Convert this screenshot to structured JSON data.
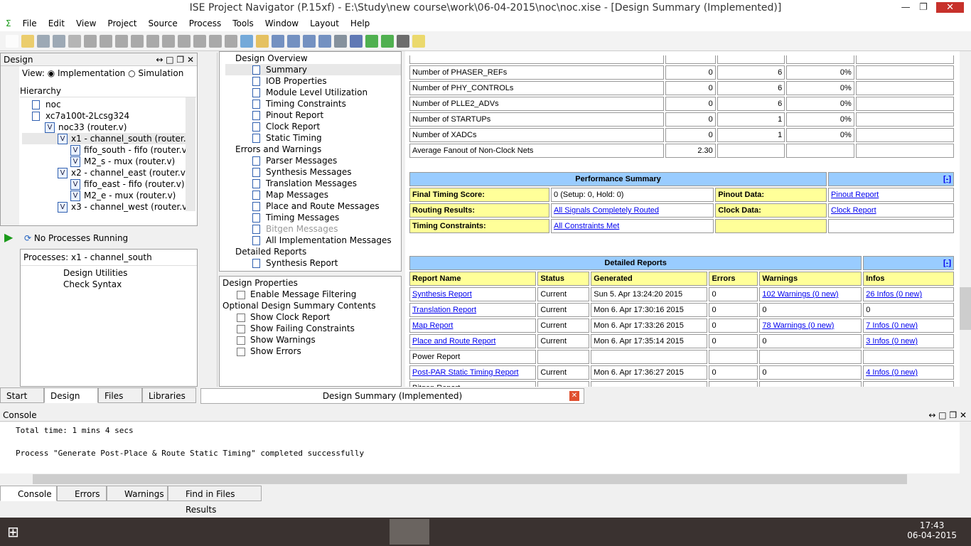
{
  "window": {
    "title": "ISE Project Navigator (P.15xf) - E:\\Study\\new course\\work\\06-04-2015\\noc\\noc.xise - [Design Summary (Implemented)]"
  },
  "menu": [
    "File",
    "Edit",
    "View",
    "Project",
    "Source",
    "Process",
    "Tools",
    "Window",
    "Layout",
    "Help"
  ],
  "design": {
    "title": "Design",
    "view_label": "View:",
    "impl": "Implementation",
    "sim": "Simulation",
    "hierarchy": "Hierarchy",
    "tree": [
      "noc",
      "xc7a100t-2Lcsg324",
      "noc33 (router.v)",
      "x1 - channel_south (router.v)",
      "fifo_south - fifo (router.v)",
      "M2_s - mux (router.v)",
      "x2 - channel_east (router.v)",
      "fifo_east - fifo (router.v)",
      "M2_e - mux (router.v)",
      "x3 - channel_west (router.v)"
    ],
    "status": "No Processes Running",
    "processes_title": "Processes: x1 - channel_south",
    "processes": [
      "Design Utilities",
      "Check Syntax"
    ]
  },
  "left_tabs": [
    "Start",
    "Design",
    "Files",
    "Libraries"
  ],
  "nav": {
    "items": [
      {
        "t": "Design Overview",
        "l": 0
      },
      {
        "t": "Summary",
        "l": 1
      },
      {
        "t": "IOB Properties",
        "l": 1
      },
      {
        "t": "Module Level Utilization",
        "l": 1
      },
      {
        "t": "Timing Constraints",
        "l": 1
      },
      {
        "t": "Pinout Report",
        "l": 1
      },
      {
        "t": "Clock Report",
        "l": 1
      },
      {
        "t": "Static Timing",
        "l": 1
      },
      {
        "t": "Errors and Warnings",
        "l": 0
      },
      {
        "t": "Parser Messages",
        "l": 1
      },
      {
        "t": "Synthesis Messages",
        "l": 1
      },
      {
        "t": "Translation Messages",
        "l": 1
      },
      {
        "t": "Map Messages",
        "l": 1
      },
      {
        "t": "Place and Route Messages",
        "l": 1
      },
      {
        "t": "Timing Messages",
        "l": 1
      },
      {
        "t": "Bitgen Messages",
        "l": 1
      },
      {
        "t": "All Implementation Messages",
        "l": 1
      },
      {
        "t": "Detailed Reports",
        "l": 0
      },
      {
        "t": "Synthesis Report",
        "l": 1
      }
    ]
  },
  "props": {
    "title": "Design Properties",
    "enable": "Enable Message Filtering",
    "optional": "Optional Design Summary Contents",
    "options": [
      "Show Clock Report",
      "Show Failing Constraints",
      "Show Warnings",
      "Show Errors"
    ]
  },
  "util_rows": [
    [
      "Number of PHASER_REFs",
      "0",
      "6",
      "0%"
    ],
    [
      "Number of PHY_CONTROLs",
      "0",
      "6",
      "0%"
    ],
    [
      "Number of PLLE2_ADVs",
      "0",
      "6",
      "0%"
    ],
    [
      "Number of STARTUPs",
      "0",
      "1",
      "0%"
    ],
    [
      "Number of XADCs",
      "0",
      "1",
      "0%"
    ],
    [
      "Average Fanout of Non-Clock Nets",
      "2.30",
      "",
      ""
    ]
  ],
  "perf": {
    "title": "Performance Summary",
    "toggle": "[-]",
    "rows": [
      [
        "Final Timing Score:",
        "0 (Setup: 0, Hold: 0)",
        "Pinout Data:",
        "Pinout Report"
      ],
      [
        "Routing Results:",
        "All Signals Completely Routed",
        "Clock Data:",
        "Clock Report"
      ],
      [
        "Timing Constraints:",
        "All Constraints Met",
        "",
        ""
      ]
    ]
  },
  "reports": {
    "title": "Detailed Reports",
    "toggle": "[-]",
    "headers": [
      "Report Name",
      "Status",
      "Generated",
      "Errors",
      "Warnings",
      "Infos"
    ],
    "rows": [
      [
        "Synthesis Report",
        "Current",
        "Sun 5. Apr 13:24:20 2015",
        "0",
        "102 Warnings (0 new)",
        "26 Infos (0 new)"
      ],
      [
        "Translation Report",
        "Current",
        "Mon 6. Apr 17:30:16 2015",
        "0",
        "0",
        "0"
      ],
      [
        "Map Report",
        "Current",
        "Mon 6. Apr 17:33:26 2015",
        "0",
        "78 Warnings (0 new)",
        "7 Infos (0 new)"
      ],
      [
        "Place and Route Report",
        "Current",
        "Mon 6. Apr 17:35:14 2015",
        "0",
        "0",
        "3 Infos (0 new)"
      ],
      [
        "Power Report",
        "",
        "",
        "",
        "",
        ""
      ],
      [
        "Post-PAR Static Timing Report",
        "Current",
        "Mon 6. Apr 17:36:27 2015",
        "0",
        "0",
        "4 Infos (0 new)"
      ],
      [
        "Bitgen Report",
        "",
        "",
        "",
        "",
        ""
      ]
    ]
  },
  "doc_tab": "Design Summary (Implemented)",
  "console": {
    "title": "Console",
    "lines": [
      "Total time: 1 mins 4 secs",
      "",
      "Process \"Generate Post-Place & Route Static Timing\" completed successfully"
    ]
  },
  "bottom_tabs": [
    "Console",
    "Errors",
    "Warnings",
    "Find in Files Results"
  ],
  "clock": {
    "time": "17:43",
    "date": "06-04-2015"
  }
}
